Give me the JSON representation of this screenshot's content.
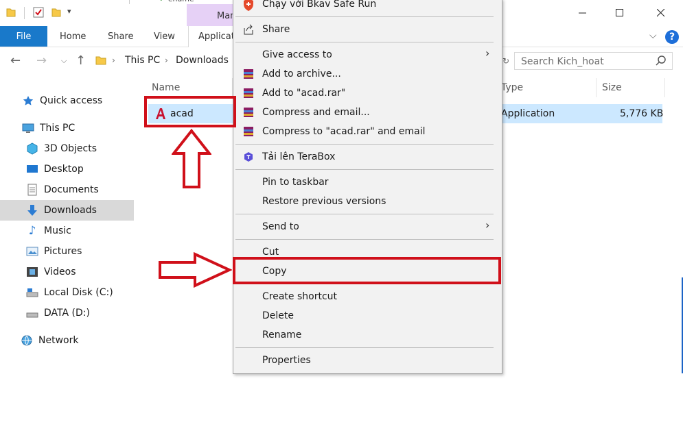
{
  "titlebar": {
    "manage_label": "Man",
    "tab_partial": "ename"
  },
  "ribbon": {
    "file": "File",
    "home": "Home",
    "share": "Share",
    "view": "View",
    "active_tab": "Applicatio"
  },
  "address": {
    "this_pc": "This PC",
    "downloads": "Downloads"
  },
  "search": {
    "placeholder": "Search Kich_hoat"
  },
  "nav_pane": {
    "quick_access": "Quick access",
    "this_pc": "This PC",
    "objects3d": "3D Objects",
    "desktop": "Desktop",
    "documents": "Documents",
    "downloads": "Downloads",
    "music": "Music",
    "pictures": "Pictures",
    "videos": "Videos",
    "local_disk": "Local Disk (C:)",
    "data_disk": "DATA (D:)",
    "network": "Network"
  },
  "columns": {
    "name": "Name",
    "type": "Type",
    "size": "Size"
  },
  "file": {
    "name": "acad",
    "type": "Application",
    "size": "5,776 KB"
  },
  "context_menu": {
    "bkav": "Chạy với Bkav Safe Run",
    "share": "Share",
    "give_access": "Give access to",
    "add_archive": "Add to archive...",
    "add_rar": "Add to \"acad.rar\"",
    "compress_email": "Compress and email...",
    "compress_rar_email": "Compress to \"acad.rar\" and email",
    "terabox": "Tải lên TeraBox",
    "pin_taskbar": "Pin to taskbar",
    "restore": "Restore previous versions",
    "send_to": "Send to",
    "cut": "Cut",
    "copy": "Copy",
    "create_shortcut": "Create shortcut",
    "delete": "Delete",
    "rename": "Rename",
    "properties": "Properties"
  },
  "colors": {
    "accent": "#1979ca",
    "highlight": "#d0101a",
    "selection": "#cce8ff"
  }
}
